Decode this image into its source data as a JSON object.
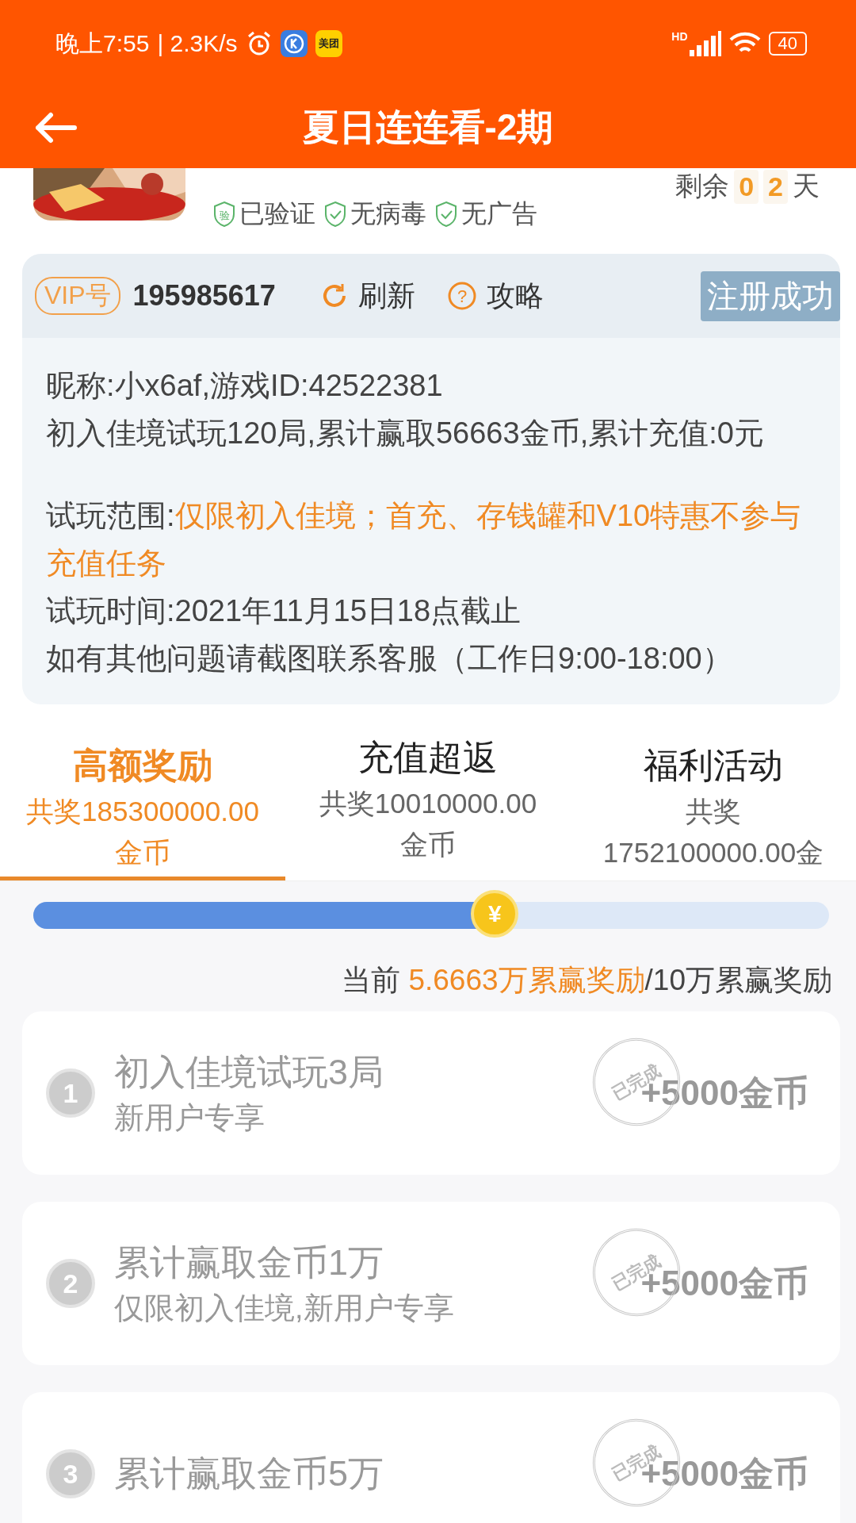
{
  "status_bar": {
    "time": "晚上7:55",
    "speed": "| 2.3K/s",
    "app_badges": [
      "美团"
    ],
    "network": "HD",
    "battery": "40"
  },
  "header": {
    "title": "夏日连连看-2期"
  },
  "game": {
    "remaining_label": "剩余",
    "remaining_digits": [
      "0",
      "2"
    ],
    "remaining_unit": "天",
    "badges": [
      {
        "label": "已验证",
        "kind": "seal",
        "seal": "验"
      },
      {
        "label": "无病毒",
        "kind": "check"
      },
      {
        "label": "无广告",
        "kind": "check"
      }
    ]
  },
  "account": {
    "vip_label": "VIP号",
    "vip_number": "195985617",
    "refresh": "刷新",
    "guide": "攻略",
    "guide_symbol": "?",
    "status": "注册成功",
    "sections": [
      [
        {
          "text": "昵称:小x6af,游戏ID:42522381"
        },
        {
          "text": "初入佳境试玩120局,累计赢取56663金币,累计充值:0元"
        }
      ],
      [
        {
          "text": "试玩范围:",
          "value": "仅限初入佳境；首充、存钱罐和V10特惠不参与充值任务"
        },
        {
          "text": "试玩时间:2021年11月15日18点截止"
        },
        {
          "text": "如有其他问题请截图联系客服（工作日9:00-18:00）"
        }
      ]
    ]
  },
  "tabs": [
    {
      "title": "高额奖励",
      "lines": [
        "共奖185300000.00",
        "金币"
      ],
      "selected": true
    },
    {
      "title": "充值超返",
      "lines": [
        "共奖10010000.00",
        "金币"
      ],
      "selected": false
    },
    {
      "title": "福利活动",
      "lines": [
        "共奖",
        "1752100000.00金"
      ],
      "selected": false
    }
  ],
  "progress": {
    "level": 0.58,
    "thumb_symbol": "¥",
    "prefix": "当前 ",
    "current": "5.6663万累赢奖励",
    "total": "/10万累赢奖励"
  },
  "tasks": [
    {
      "number": "1",
      "title": "初入佳境试玩3局",
      "subtitle": "新用户专享",
      "reward": "+5000金币",
      "stamp": "已完成",
      "completed": true
    },
    {
      "number": "2",
      "title": "累计赢取金币1万",
      "subtitle": "仅限初入佳境,新用户专享",
      "reward": "+5000金币",
      "stamp": "已完成",
      "completed": true
    },
    {
      "number": "3",
      "title": "累计赢取金币5万",
      "reward": "+5000金币",
      "stamp": "已完成",
      "completed": true
    }
  ]
}
